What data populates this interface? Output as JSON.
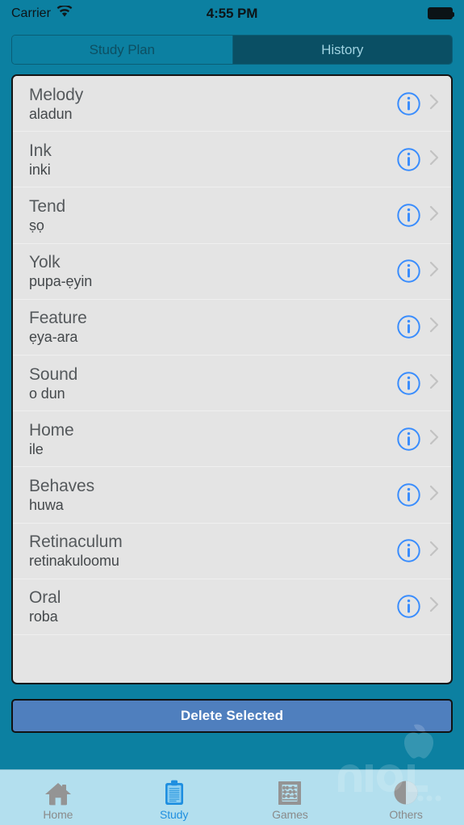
{
  "status_bar": {
    "carrier": "Carrier",
    "wifi_icon": "wifi-icon",
    "time": "4:55 PM",
    "battery_icon": "battery-full-icon"
  },
  "segmented_control": {
    "tabs": [
      {
        "label": "Study Plan",
        "selected": false
      },
      {
        "label": "History",
        "selected": true
      }
    ]
  },
  "list": {
    "info_icon": "info-circle-icon",
    "chevron_icon": "chevron-right-icon",
    "rows": [
      {
        "title": "Melody",
        "subtitle": "aladun"
      },
      {
        "title": "Ink",
        "subtitle": "inki"
      },
      {
        "title": "Tend",
        "subtitle": "ṣọ"
      },
      {
        "title": "Yolk",
        "subtitle": "pupa-ẹyin"
      },
      {
        "title": "Feature",
        "subtitle": "ẹya-ara"
      },
      {
        "title": "Sound",
        "subtitle": "o dun"
      },
      {
        "title": "Home",
        "subtitle": "ile"
      },
      {
        "title": "Behaves",
        "subtitle": "huwa"
      },
      {
        "title": "Retinaculum",
        "subtitle": "retinakuloomu"
      },
      {
        "title": "Oral",
        "subtitle": "roba"
      }
    ]
  },
  "actions": {
    "delete_label": "Delete Selected"
  },
  "tab_bar": {
    "items": [
      {
        "label": "Home",
        "icon": "house-icon",
        "active": false
      },
      {
        "label": "Study",
        "icon": "clipboard-icon",
        "active": true
      },
      {
        "label": "Games",
        "icon": "abacus-icon",
        "active": false
      },
      {
        "label": "Others",
        "icon": "pie-chart-icon",
        "active": false
      }
    ]
  },
  "colors": {
    "background_teal": "#0c80a1",
    "segment_selected": "#0a4f64",
    "list_background": "#e4e4e4",
    "info_blue": "#3a8dfd",
    "delete_button": "#4f7fbe",
    "tabbar_background": "#b3dfee",
    "tab_active": "#1f8fe0",
    "tab_inactive": "#8a8a8a"
  }
}
